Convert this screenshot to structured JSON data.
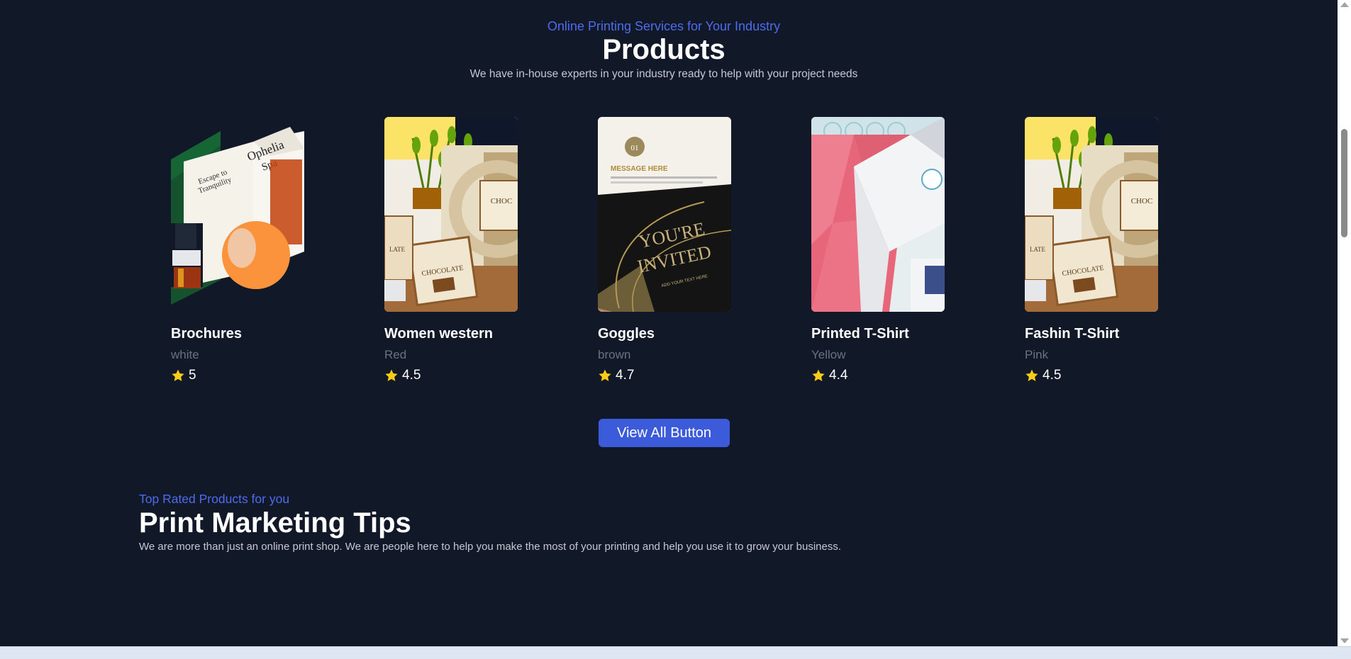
{
  "products_section": {
    "eyebrow": "Online Printing Services for Your Industry",
    "title": "Products",
    "subtitle": "We have in-house experts in your industry ready to help with your project needs"
  },
  "products": [
    {
      "name": "Brochures",
      "color": "white",
      "rating": "5",
      "image": "brochure-image"
    },
    {
      "name": "Women western",
      "color": "Red",
      "rating": "4.5",
      "image": "chocolate-labels-image"
    },
    {
      "name": "Goggles",
      "color": "brown",
      "rating": "4.7",
      "image": "invitation-card-image"
    },
    {
      "name": "Printed T-Shirt",
      "color": "Yellow",
      "rating": "4.4",
      "image": "pink-box-image"
    },
    {
      "name": "Fashin T-Shirt",
      "color": "Pink",
      "rating": "4.5",
      "image": "chocolate-labels-image"
    }
  ],
  "view_all_button": "View All Button",
  "tips_section": {
    "eyebrow": "Top Rated Products for you",
    "title": "Print Marketing Tips",
    "subtitle": "We are more than just an online print shop. We are people here to help you make the most of your printing and help you use it to grow your business."
  },
  "colors": {
    "background": "#111827",
    "accent": "#3b5bdb",
    "eyebrow": "#4f6bed",
    "star": "#facc15"
  }
}
